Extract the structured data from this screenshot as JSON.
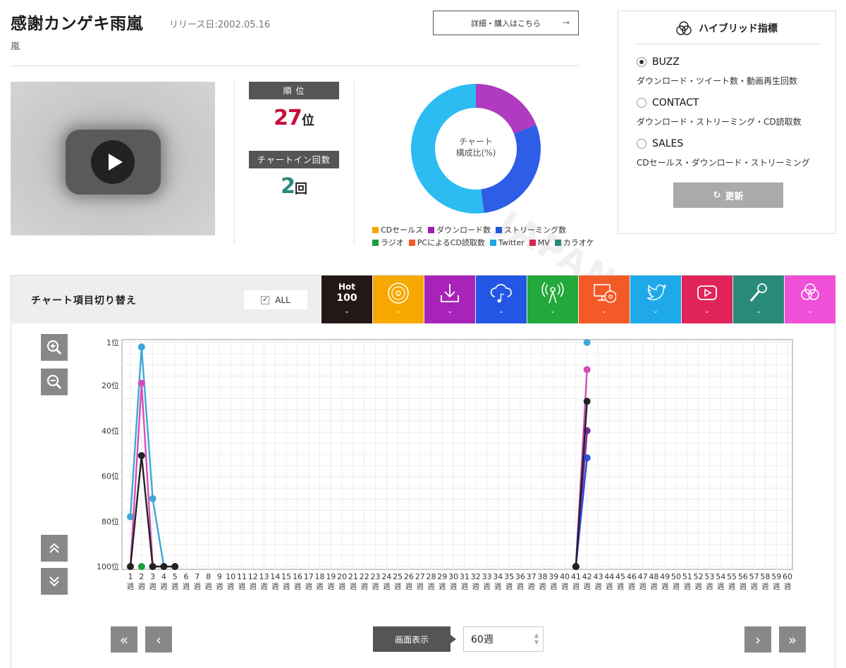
{
  "header": {
    "title": "感謝カンゲキ雨嵐",
    "release": "リリース日:2002.05.16",
    "artist": "嵐",
    "buy_label": "詳細・購入はこちら",
    "buy_arrow": "⇾"
  },
  "watermark": "JAPAN",
  "rank": {
    "rank_label": "順 位",
    "rank_value": "27",
    "rank_unit": "位",
    "chartin_label": "チャートイン回数",
    "chartin_value": "2",
    "chartin_unit": "回",
    "colors": {
      "rank": "#c8103e",
      "chartin": "#2a8a7a"
    }
  },
  "composition": {
    "center_line1": "チャート",
    "center_line2": "構成比(%)",
    "slices": [
      {
        "name": "ダウンロード数",
        "value": 19,
        "color": "#b03ac0"
      },
      {
        "name": "ストリーミング数",
        "value": 29,
        "color": "#2e5ee8"
      },
      {
        "name": "Twitter",
        "value": 52,
        "color": "#2cbcf2"
      }
    ],
    "legend_row1": [
      {
        "label": "CDセールス",
        "color": "#f7a800"
      },
      {
        "label": "ダウンロード数",
        "color": "#9b1fae"
      },
      {
        "label": "ストリーミング数",
        "color": "#2358e0"
      }
    ],
    "legend_row2": [
      {
        "label": "ラジオ",
        "color": "#1e9e3a"
      },
      {
        "label": "PCによるCD読取数",
        "color": "#f25a2a"
      },
      {
        "label": "Twitter",
        "color": "#1aa9e8"
      },
      {
        "label": "MV",
        "color": "#d8234c"
      },
      {
        "label": "カラオケ",
        "color": "#2a8a7a"
      }
    ]
  },
  "hybrid": {
    "title": "ハイブリッド指標",
    "options": [
      {
        "label": "BUZZ",
        "desc": "ダウンロード・ツイート数・動画再生回数",
        "selected": true
      },
      {
        "label": "CONTACT",
        "desc": "ダウンロード・ストリーミング・CD読取数",
        "selected": false
      },
      {
        "label": "SALES",
        "desc": "CDセールス・ダウンロード・ストリーミング",
        "selected": false
      }
    ],
    "update_label": "更新",
    "update_icon": "↻"
  },
  "chart_toggle": {
    "title": "チャート項目切り替え",
    "all_label": "ALL",
    "all_checked": "✓",
    "tabs": [
      {
        "id": "hot100",
        "label_a": "Hot",
        "label_b": "100",
        "color": "#231815",
        "icon": "hot100"
      },
      {
        "id": "cd",
        "color": "#f7a800",
        "icon": "cd-icon"
      },
      {
        "id": "download",
        "color": "#a824b8",
        "icon": "download-icon"
      },
      {
        "id": "streaming",
        "color": "#2456e6",
        "icon": "cloud-music-icon"
      },
      {
        "id": "radio",
        "color": "#23a83b",
        "icon": "radio-icon"
      },
      {
        "id": "pc",
        "color": "#f35a28",
        "icon": "pc-cd-icon"
      },
      {
        "id": "twitter",
        "color": "#1eaaea",
        "icon": "twitter-icon"
      },
      {
        "id": "mv",
        "color": "#e0245a",
        "icon": "youtube-icon"
      },
      {
        "id": "karaoke",
        "color": "#2a8a7a",
        "icon": "mic-icon"
      },
      {
        "id": "hybrid",
        "color": "#f050d8",
        "icon": "hybrid-icon"
      }
    ],
    "chevron": "⌄"
  },
  "chart_data": {
    "type": "line",
    "x_range": [
      1,
      60
    ],
    "x_suffix": "週",
    "y_range": [
      1,
      100
    ],
    "y_inverted": true,
    "y_ticks": [
      "1位",
      "20位",
      "40位",
      "60位",
      "80位",
      "100位"
    ],
    "y_tick_values": [
      1,
      20,
      40,
      60,
      80,
      100
    ],
    "grid": true,
    "series": [
      {
        "color": "#3ea8d6",
        "points": [
          [
            1,
            78
          ],
          [
            2,
            3
          ],
          [
            3,
            70
          ],
          [
            4,
            100
          ],
          [
            42,
            1
          ]
        ]
      },
      {
        "color": "#d24fb8",
        "points": [
          [
            1,
            100
          ],
          [
            2,
            19
          ],
          [
            3,
            100
          ],
          [
            41,
            100
          ],
          [
            42,
            13
          ]
        ]
      },
      {
        "color": "#7a2a9c",
        "points": [
          [
            41,
            100
          ],
          [
            42,
            40
          ]
        ]
      },
      {
        "color": "#2e4fe0",
        "points": [
          [
            41,
            100
          ],
          [
            42,
            52
          ]
        ]
      },
      {
        "color": "#1e9e3a",
        "points": [
          [
            2,
            100
          ]
        ]
      },
      {
        "color": "#222222",
        "points": [
          [
            1,
            100
          ],
          [
            2,
            51
          ],
          [
            3,
            100
          ],
          [
            4,
            100
          ],
          [
            5,
            100
          ],
          [
            41,
            100
          ],
          [
            42,
            27
          ]
        ]
      }
    ]
  },
  "view": {
    "label": "画面表示",
    "select_value": "60週"
  },
  "pager": {
    "first": "«",
    "prev": "‹",
    "next": "›",
    "last": "»"
  }
}
